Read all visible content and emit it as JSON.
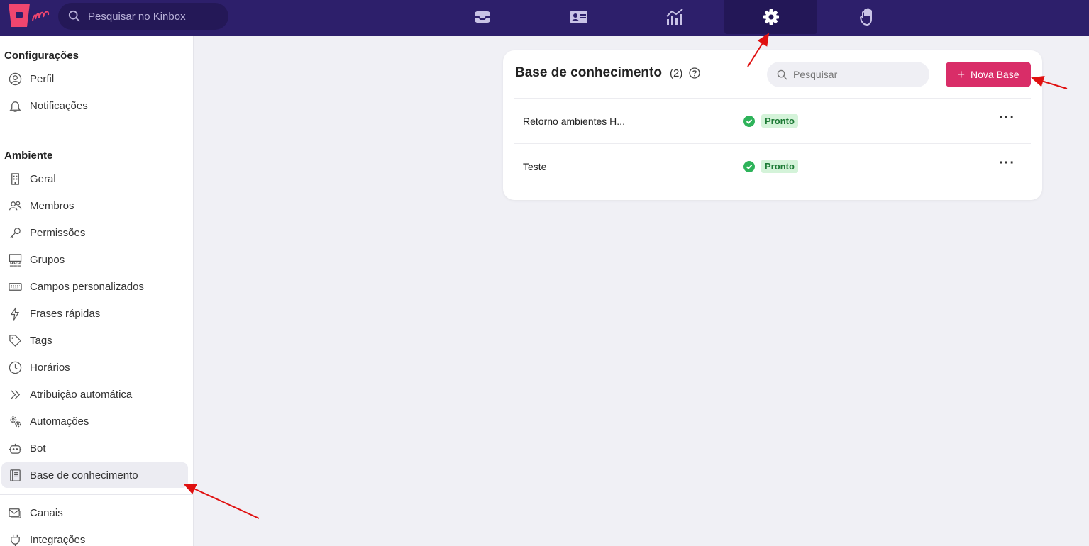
{
  "topbar": {
    "search_placeholder": "Pesquisar no Kinbox",
    "nav": [
      "inbox-icon",
      "contact-card-icon",
      "analytics-icon",
      "gear-icon",
      "hand-icon"
    ],
    "active_nav": "gear-icon",
    "colors": {
      "bg": "#2d1f6b",
      "logo": "#f0466f"
    }
  },
  "sidebar": {
    "section1_title": "Configurações",
    "section1_items": [
      {
        "label": "Perfil",
        "icon": "user-circle-icon"
      },
      {
        "label": "Notificações",
        "icon": "bell-icon"
      }
    ],
    "section2_title": "Ambiente",
    "section2_items": [
      {
        "label": "Geral",
        "icon": "building-icon"
      },
      {
        "label": "Membros",
        "icon": "users-icon"
      },
      {
        "label": "Permissões",
        "icon": "key-icon"
      },
      {
        "label": "Grupos",
        "icon": "group-icon"
      },
      {
        "label": "Campos personalizados",
        "icon": "keyboard-icon"
      },
      {
        "label": "Frases rápidas",
        "icon": "lightning-icon"
      },
      {
        "label": "Tags",
        "icon": "tag-icon"
      },
      {
        "label": "Horários",
        "icon": "clock-icon"
      },
      {
        "label": "Atribuição automática",
        "icon": "double-chevron-icon"
      },
      {
        "label": "Automações",
        "icon": "gears-icon"
      },
      {
        "label": "Bot",
        "icon": "robot-icon"
      },
      {
        "label": "Base de conhecimento",
        "icon": "book-icon",
        "active": true
      }
    ],
    "section3_items": [
      {
        "label": "Canais",
        "icon": "envelope-icon"
      },
      {
        "label": "Integrações",
        "icon": "plug-icon"
      }
    ]
  },
  "main": {
    "title": "Base de conhecimento",
    "count": "(2)",
    "search_placeholder": "Pesquisar",
    "new_button_label": "Nova Base",
    "rows": [
      {
        "name": "Retorno ambientes H...",
        "status": "Pronto"
      },
      {
        "name": "Teste",
        "status": "Pronto"
      }
    ],
    "more_label": "···",
    "colors": {
      "accent": "#d92d68",
      "status_bg": "#d4f3d9",
      "status_text": "#1d7a35",
      "check": "#2eb35a"
    }
  }
}
